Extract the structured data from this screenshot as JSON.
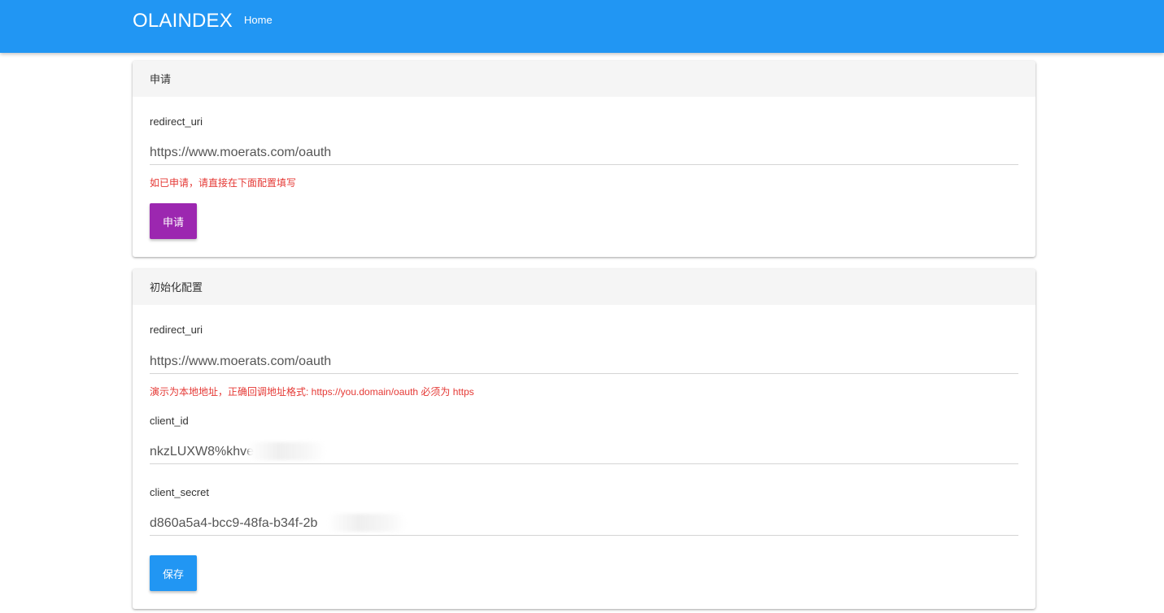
{
  "nav": {
    "brand": "OLAINDEX",
    "home_label": "Home",
    "bar_color": "#2196f3"
  },
  "apply_card": {
    "title": "申请",
    "redirect_label": "redirect_uri",
    "redirect_value": "https://www.moerats.com/oauth",
    "help": "如已申请，请直接在下面配置填写",
    "button_label": "申请",
    "button_color": "#9c27b0"
  },
  "init_card": {
    "title": "初始化配置",
    "redirect_label": "redirect_uri",
    "redirect_value": "https://www.moerats.com/oauth",
    "redirect_help": "演示为本地地址，正确回调地址格式: https://you.domain/oauth 必须为 https",
    "client_id_label": "client_id",
    "client_id_value": "nkzLUXW8%khve",
    "client_secret_label": "client_secret",
    "client_secret_value": "d860a5a4-bcc9-48fa-b34f-2b",
    "save_label": "保存",
    "save_color": "#2196f3"
  },
  "colors": {
    "help_text": "#e53935",
    "header_bg": "#f5f5f5"
  }
}
